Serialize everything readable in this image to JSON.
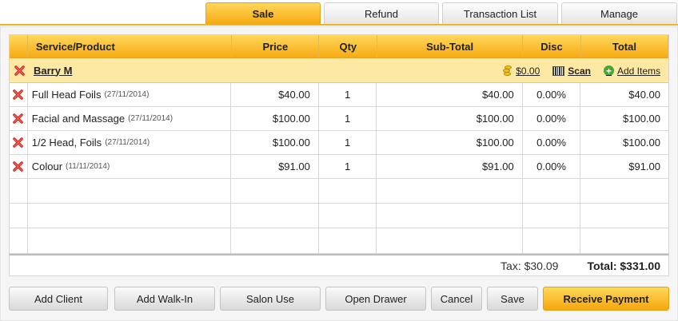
{
  "tabs": [
    {
      "label": "Sale",
      "active": true
    },
    {
      "label": "Refund",
      "active": false
    },
    {
      "label": "Transaction List",
      "active": false
    },
    {
      "label": "Manage",
      "active": false
    }
  ],
  "table": {
    "headers": {
      "service": "Service/Product",
      "price": "Price",
      "qty": "Qty",
      "subtotal": "Sub-Total",
      "disc": "Disc",
      "total": "Total"
    },
    "client": {
      "name": "Barry M",
      "balance": "$0.00",
      "scan_label": "Scan",
      "add_items_label": "Add Items"
    },
    "items": [
      {
        "name": "Full Head Foils",
        "date": "(27/11/2014)",
        "price": "$40.00",
        "qty": "1",
        "subtotal": "$40.00",
        "disc": "0.00%",
        "total": "$40.00"
      },
      {
        "name": "Facial and Massage",
        "date": "(27/11/2014)",
        "price": "$100.00",
        "qty": "1",
        "subtotal": "$100.00",
        "disc": "0.00%",
        "total": "$100.00"
      },
      {
        "name": "1/2 Head, Foils",
        "date": "(27/11/2014)",
        "price": "$100.00",
        "qty": "1",
        "subtotal": "$100.00",
        "disc": "0.00%",
        "total": "$100.00"
      },
      {
        "name": "Colour",
        "date": "(11/11/2014)",
        "price": "$91.00",
        "qty": "1",
        "subtotal": "$91.00",
        "disc": "0.00%",
        "total": "$91.00"
      }
    ]
  },
  "summary": {
    "tax": "Tax: $30.09",
    "total": "Total: $331.00"
  },
  "actions": {
    "add_client": "Add Client",
    "add_walk_in": "Add Walk-In",
    "salon_use": "Salon Use",
    "open_drawer": "Open Drawer",
    "cancel": "Cancel",
    "save": "Save",
    "receive_payment": "Receive Payment"
  },
  "colors": {
    "accent": "#f7ab14",
    "accent_light": "#ffd85b",
    "client_row": "#fde8a4",
    "delete_red": "#d42020"
  },
  "icons": {
    "delete": "delete-x-icon",
    "balance": "coins-icon",
    "scan": "barcode-icon",
    "add_items": "plus-circle-icon"
  }
}
